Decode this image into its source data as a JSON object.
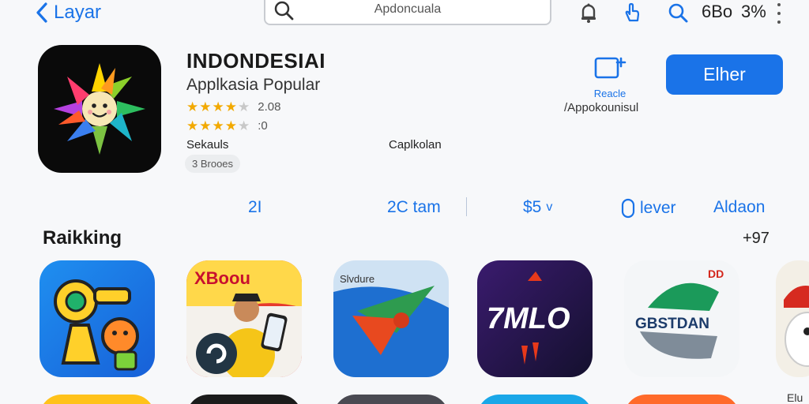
{
  "topbar": {
    "back_label": "Layar",
    "search_placeholder": "Apdoncuala",
    "status_time": "6Bo",
    "status_battery": "3%"
  },
  "app": {
    "title": "INDONDESIAI",
    "subtitle": "Applkasia Popular",
    "rating1_stars": 4,
    "rating1_value": "2.08",
    "rating2_stars": 4,
    "rating2_value": ":0",
    "meta_left": "Sekauls",
    "meta_mid": "Caplkolan",
    "chip": "3 Brooes",
    "share_label": "Reacle",
    "share_caption": "/Appokounisul",
    "get_button": "Elher"
  },
  "stats": {
    "s1": "2I",
    "s2": "2C tam",
    "s3": "$5",
    "s3_chevron": "v",
    "s4": "lever",
    "s5": "Aldaon"
  },
  "ranking": {
    "title": "Raikking",
    "count": "+97",
    "tiles": [
      {
        "name": "puzzle-app"
      },
      {
        "name": "food-app",
        "label": "XBoou"
      },
      {
        "name": "navigation-app",
        "label": "Slvdure"
      },
      {
        "name": "music-app",
        "label": "7MLO"
      },
      {
        "name": "gb-app",
        "label": "GBSTDAN",
        "badge": "DD"
      },
      {
        "name": "game-app"
      }
    ],
    "edge_text": "Elu"
  },
  "colors": {
    "accent": "#1a73e8",
    "star": "#f2a900",
    "background": "#f7f8fa"
  }
}
